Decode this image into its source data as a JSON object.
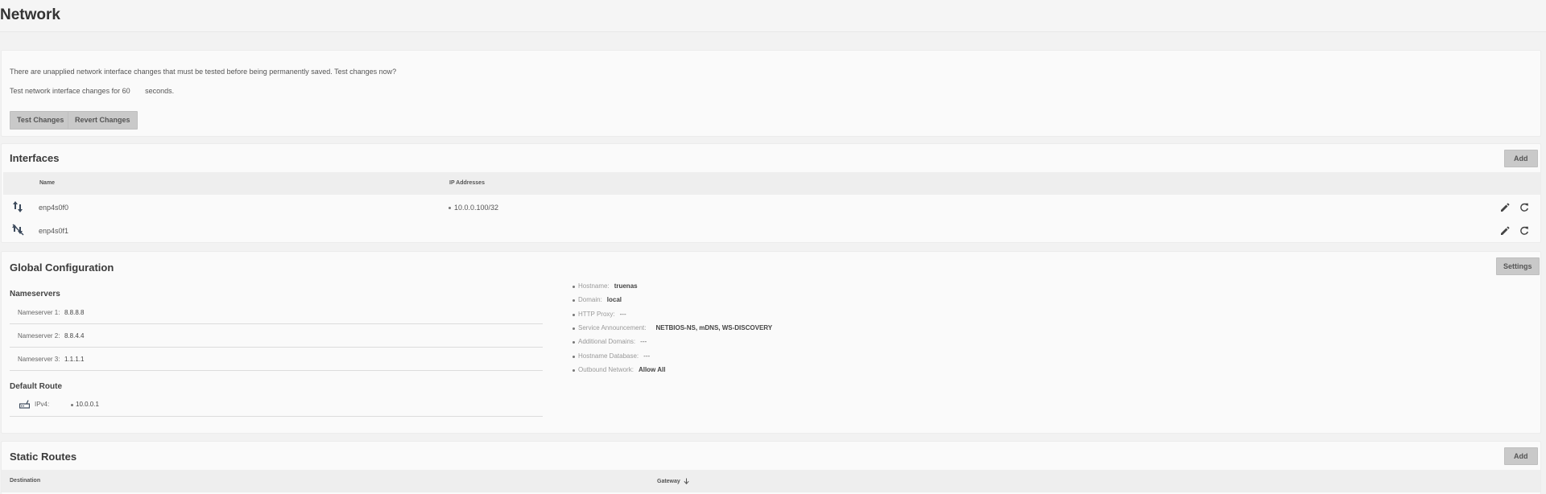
{
  "page": {
    "title": "Network"
  },
  "pending": {
    "message": "There are unapplied network interface changes that must be tested before being permanently saved. Test changes now?",
    "test_prefix": "Test network interface changes for",
    "seconds_value": "60",
    "seconds_suffix": "seconds.",
    "test_button": "Test Changes",
    "revert_button": "Revert Changes"
  },
  "interfaces": {
    "title": "Interfaces",
    "add_button": "Add",
    "columns": {
      "name": "Name",
      "ip": "IP Addresses"
    },
    "rows": [
      {
        "name": "enp4s0f0",
        "ip": "10.0.0.100/32",
        "state_icon": "link-up-icon"
      },
      {
        "name": "enp4s0f1",
        "ip": "",
        "state_icon": "link-down-icon"
      }
    ]
  },
  "global": {
    "title": "Global Configuration",
    "settings_button": "Settings",
    "nameservers_title": "Nameservers",
    "nameservers": [
      {
        "label": "Nameserver 1:",
        "value": "8.8.8.8"
      },
      {
        "label": "Nameserver 2:",
        "value": "8.8.4.4"
      },
      {
        "label": "Nameserver 3:",
        "value": "1.1.1.1"
      }
    ],
    "default_route_title": "Default Route",
    "default_route": {
      "label": "IPv4:",
      "value": "10.0.0.1"
    },
    "info": [
      {
        "key": "Hostname:",
        "value": "truenas"
      },
      {
        "key": "Domain:",
        "value": "local"
      },
      {
        "key": "HTTP Proxy:",
        "value": "---"
      },
      {
        "key": "Service Announcement:",
        "value": "NETBIOS-NS, mDNS, WS-DISCOVERY"
      },
      {
        "key": "Additional Domains:",
        "value": "---"
      },
      {
        "key": "Hostname Database:",
        "value": "---"
      },
      {
        "key": "Outbound Network:",
        "value": "Allow All"
      }
    ]
  },
  "static_routes": {
    "title": "Static Routes",
    "add_button": "Add",
    "columns": {
      "destination": "Destination",
      "gateway": "Gateway"
    }
  },
  "colors": {
    "icon": "#3c4a5c",
    "button": "#c9c9c9"
  }
}
